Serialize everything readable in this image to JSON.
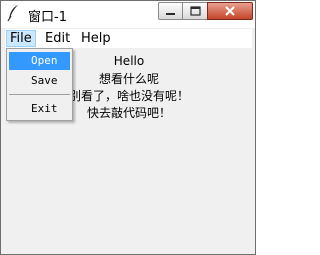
{
  "window": {
    "title": "窗口-1"
  },
  "menubar": {
    "items": [
      {
        "label": "File"
      },
      {
        "label": "Edit"
      },
      {
        "label": "Help"
      }
    ]
  },
  "file_menu": {
    "items": [
      {
        "label": "Open"
      },
      {
        "label": "Save"
      },
      {
        "label": "Exit"
      }
    ]
  },
  "content": {
    "lines": [
      "Hello",
      "想看什么呢",
      "别看了，啥也没有呢！",
      "快去敲代码吧！"
    ]
  },
  "colors": {
    "selection": "#3399ff",
    "menu_active_bg": "#cce8ff",
    "close_button": "#c4452a"
  }
}
